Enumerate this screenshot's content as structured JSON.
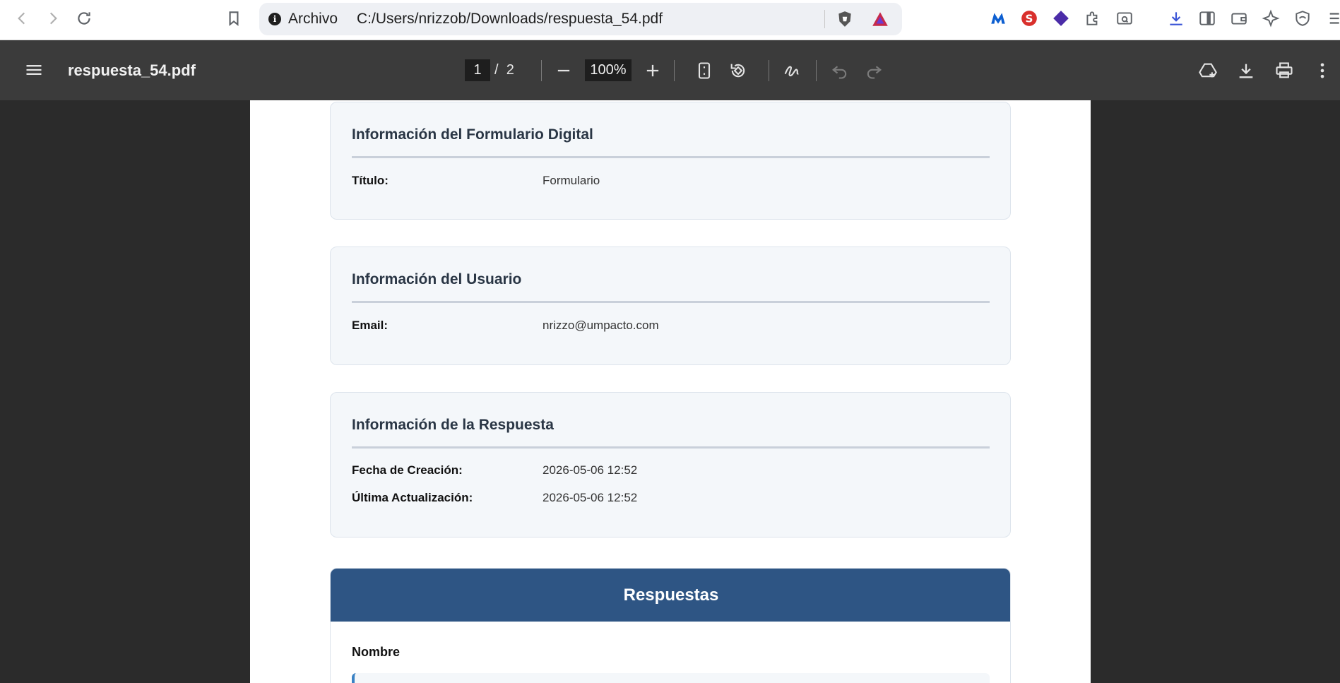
{
  "browser": {
    "scheme_label": "Archivo",
    "url": "C:/Users/nrizzob/Downloads/respuesta_54.pdf"
  },
  "viewer": {
    "filename": "respuesta_54.pdf",
    "current_page": "1",
    "page_separator": "/",
    "total_pages": "2",
    "zoom": "100%"
  },
  "document": {
    "sections": [
      {
        "title": "Información del Formulario Digital",
        "fields": [
          {
            "label": "Título:",
            "value": "Formulario"
          }
        ]
      },
      {
        "title": "Información del Usuario",
        "fields": [
          {
            "label": "Email:",
            "value": "nrizzo@umpacto.com"
          }
        ]
      },
      {
        "title": "Información de la Respuesta",
        "fields": [
          {
            "label": "Fecha de Creación:",
            "value": "2026-05-06 12:52"
          },
          {
            "label": "Última Actualización:",
            "value": "2026-05-06 12:52"
          }
        ]
      }
    ],
    "responses": {
      "header": "Respuestas",
      "first_question": "Nombre"
    }
  },
  "colors": {
    "responses_header": "#2e5584",
    "card_background": "#f4f7fa",
    "viewer_toolbar": "#3b3b3b",
    "viewer_background": "#2b2b2b"
  }
}
